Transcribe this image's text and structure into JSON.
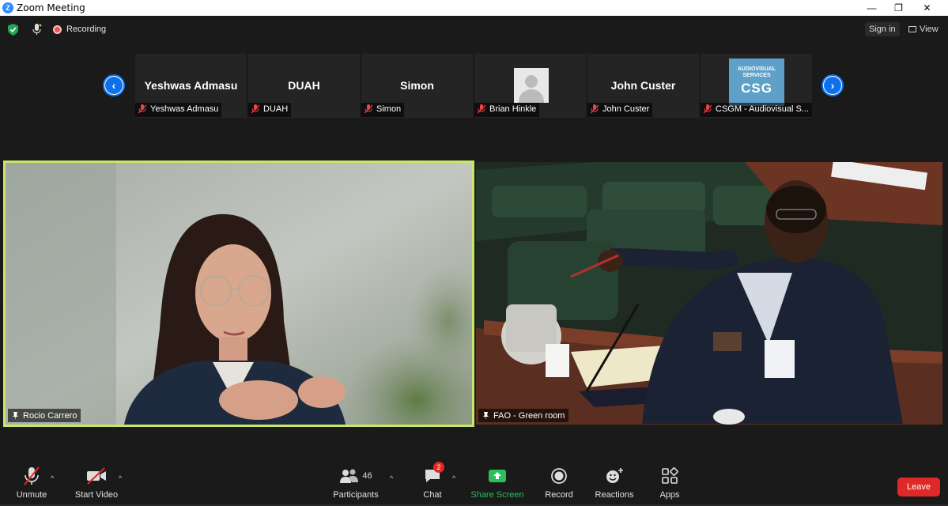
{
  "window": {
    "title": "Zoom Meeting",
    "minimize_glyph": "—",
    "restore_glyph": "❐",
    "close_glyph": "✕"
  },
  "topbar": {
    "security_icon": "shield-check-icon",
    "recording_label": "Recording",
    "sign_in_label": "Sign in",
    "view_label": "View"
  },
  "strip": {
    "prev_arrow": "‹",
    "next_arrow": "›",
    "tiles": [
      {
        "big_name": "Yeshwas Admasu",
        "label": "Yeshwas Admasu",
        "kind": "text"
      },
      {
        "big_name": "DUAH",
        "label": "DUAH",
        "kind": "text"
      },
      {
        "big_name": "Simon",
        "label": "Simon",
        "kind": "text"
      },
      {
        "big_name": "",
        "label": "Brian Hinkle",
        "kind": "avatar"
      },
      {
        "big_name": "John Custer",
        "label": "John Custer",
        "kind": "text"
      },
      {
        "big_name": "",
        "label": "CSGM - Audiovisual S...",
        "kind": "logo",
        "logo_top": "AUDIOVISUAL SERVICES",
        "logo_main": "CSG"
      }
    ]
  },
  "videos": {
    "left_name": "Rocio Carrero",
    "right_name": "FAO - Green room"
  },
  "toolbar": {
    "unmute": "Unmute",
    "start_video": "Start Video",
    "participants": "Participants",
    "participants_count": "46",
    "chat": "Chat",
    "chat_badge": "2",
    "share_screen": "Share Screen",
    "record": "Record",
    "reactions": "Reactions",
    "apps": "Apps",
    "leave": "Leave",
    "caret": "^"
  },
  "colors": {
    "accent_blue": "#0e71eb",
    "active_speaker_border": "#c9e56a",
    "share_green": "#2dbd5a",
    "leave_red": "#e02828"
  }
}
